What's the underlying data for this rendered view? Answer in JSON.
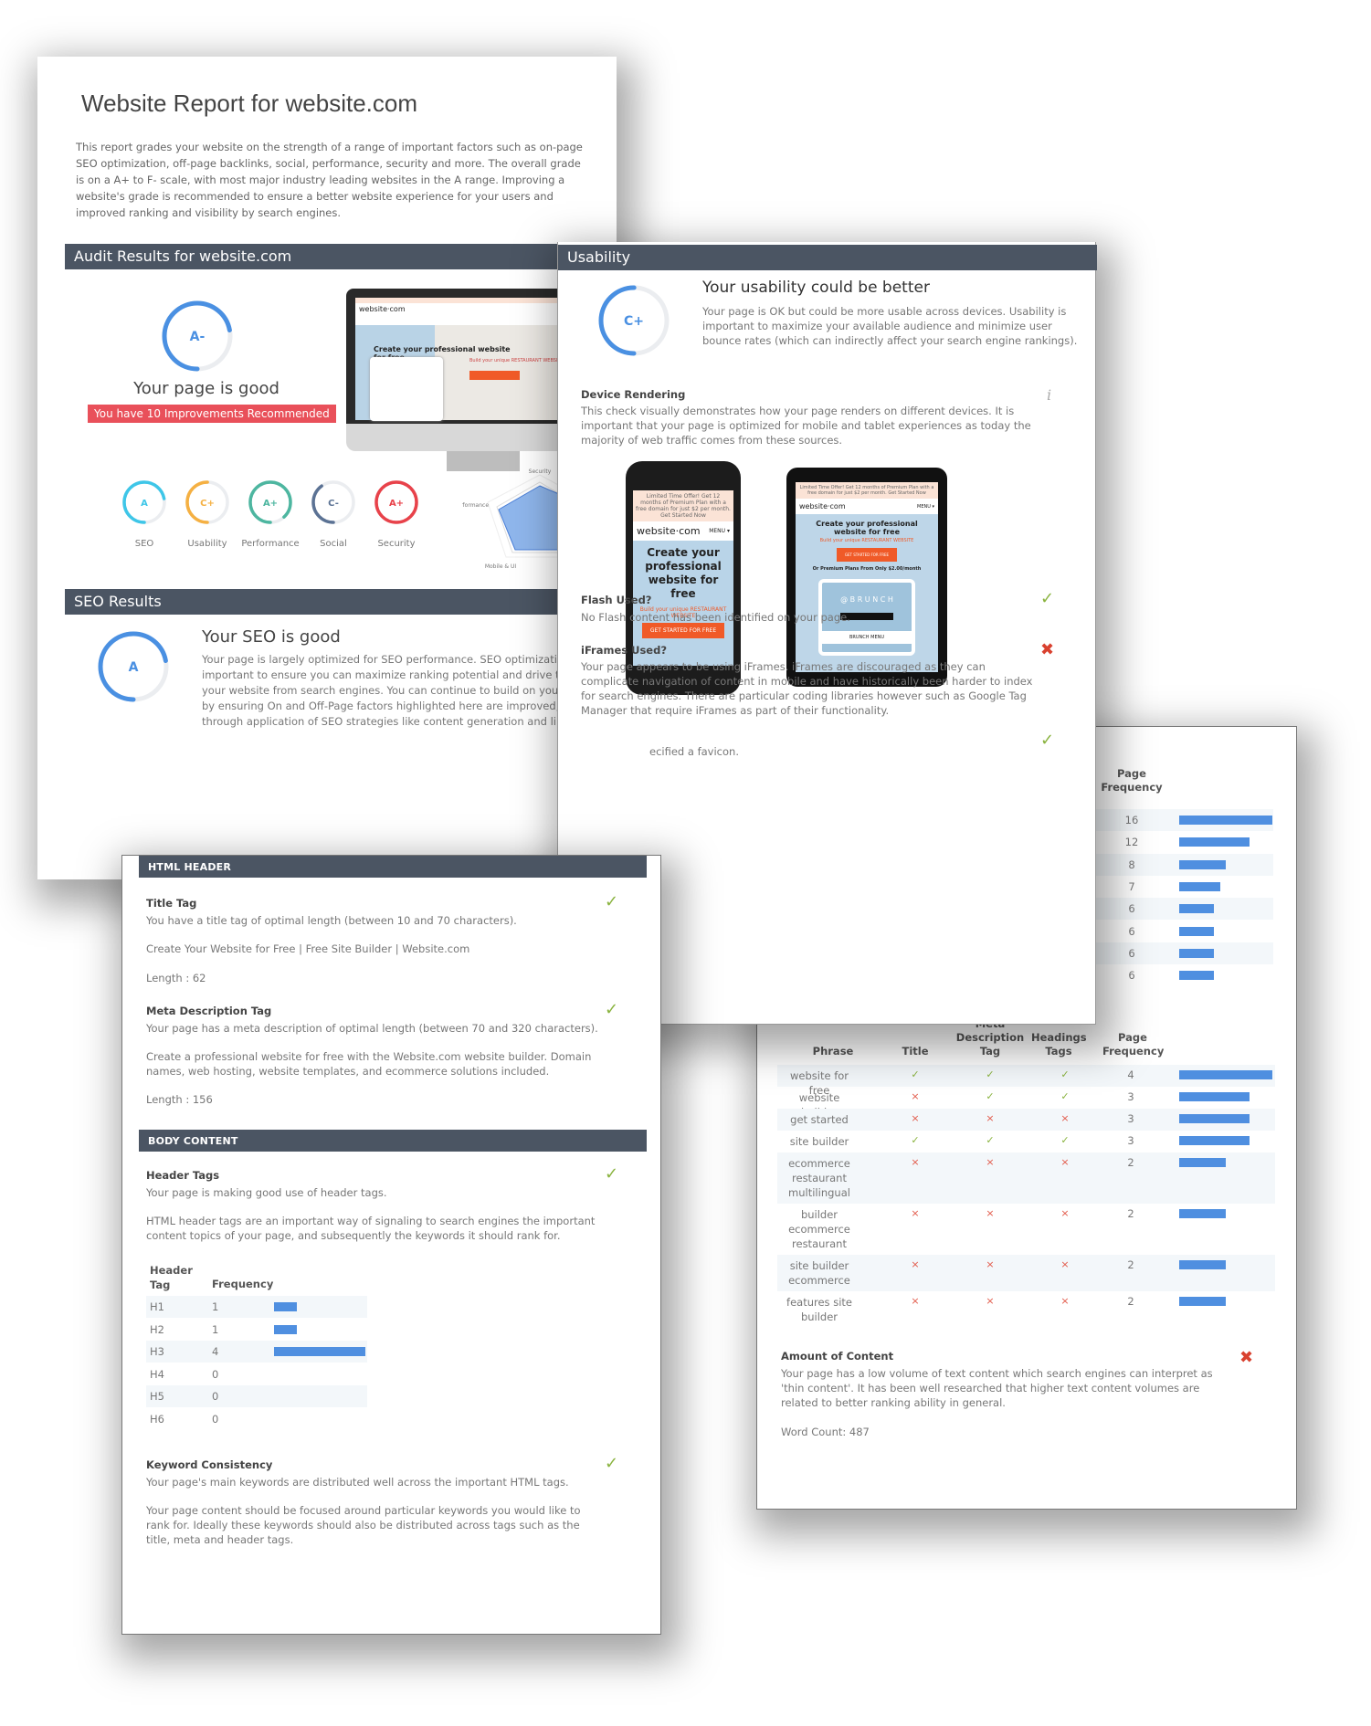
{
  "report": {
    "title": "Website Report for website.com",
    "intro": "This report grades your website on the strength of a range of important factors such as on-page SEO optimization, off-page backlinks, social, performance, security and more. The overall grade is on a A+ to F- scale, with most major industry leading websites in the A range. Improving a website's grade is recommended to ensure a better website experience for your users and improved ranking and visibility by search engines.",
    "audit_header": "Audit Results for website.com",
    "overall_grade": "A-",
    "overall_grade_progress": 0.72,
    "overall_status": "Your page is good",
    "improvements_badge": "You have 10 Improvements Recommended",
    "accent_color": "#4a90e2",
    "category_grades": [
      {
        "label": "SEO",
        "grade": "A",
        "progress": 0.72,
        "color": "#3ec6e8"
      },
      {
        "label": "Usability",
        "grade": "C+",
        "progress": 0.5,
        "color": "#f5b042"
      },
      {
        "label": "Performance",
        "grade": "A+",
        "progress": 0.88,
        "color": "#4db6a0"
      },
      {
        "label": "Social",
        "grade": "C-",
        "progress": 0.4,
        "color": "#5b7294"
      },
      {
        "label": "Security",
        "grade": "A+",
        "progress": 1.0,
        "color": "#e8424a"
      }
    ],
    "radar_labels": [
      "Security",
      "Performance",
      "Mobile & UI"
    ],
    "monitor_preview": {
      "logo": "website·com",
      "headline": "Create your professional website for free",
      "subline": "Build your unique RESTAURANT WEBSITE"
    },
    "seo_header": "SEO Results",
    "seo_grade": "A",
    "seo_grade_progress": 0.72,
    "seo_title": "Your SEO is good",
    "seo_text": [
      "Your page is largely optimized for SEO performance. SEO optimization is",
      "important to ensure you can maximize ranking potential and drive traffic to",
      "your website from search engines. You can continue to build on your positi",
      "by ensuring On and Off-Page factors highlighted here are improved, as we",
      "through application of SEO strategies like content generation and link buil"
    ]
  },
  "usability": {
    "header": "Usability",
    "grade": "C+",
    "grade_progress": 0.5,
    "title": "Your usability could be better",
    "text": "Your page is OK but could be more usable across devices. Usability is important to maximize your available audience and minimize user bounce rates (which can indirectly affect your search engine rankings).",
    "device_rendering": {
      "title": "Device Rendering",
      "text": "This check visually demonstrates how your page renders on different devices. It is important that your page is optimized for mobile and tablet experiences as today the majority of web traffic comes from these sources.",
      "info_icon": "i"
    },
    "phone_preview": {
      "ad": "Limited Time Offer! Get 12 months of Premium Plan with a free domain for just $2 per month. Get Started Now",
      "logo": "website·com",
      "menu": "MENU ▾",
      "headline": "Create your professional website for free",
      "sub": "Build your unique RESTAURANT WEBSITE",
      "cta": "GET STARTED FOR FREE"
    },
    "tablet_preview": {
      "ad": "Limited Time Offer! Get 12 months of Premium Plan with a free domain for just $2 per month. Get Started Now",
      "logo": "website·com",
      "menu": "MENU ▾",
      "headline": "Create your professional website for free",
      "sub": "Build your unique RESTAURANT WEBSITE",
      "cta": "GET STARTED FOR FREE",
      "plans": "Or Premium Plans From Only $2.00/month",
      "card": "@ B R U N C H",
      "card_footer": "BRUNCH MENU"
    },
    "checks": [
      {
        "title": "Flash Used?",
        "text": "No Flash content has been identified on your page.",
        "status": "pass"
      },
      {
        "title": "iFrames Used?",
        "text": "Your page appears to be using iFrames. iFrames are discouraged as they can complicate navigation of content in mobile and have historically been harder to index for search engines. There are particular coding libraries however such as Google Tag Manager that require iFrames as part of their functionality.",
        "status": "fail"
      },
      {
        "title": "",
        "text": "ecified a favicon.",
        "status": "pass"
      }
    ]
  },
  "keywords": {
    "top_table_header": "Page\nFrequency",
    "top_frequencies": [
      16,
      12,
      8,
      7,
      6,
      6,
      6,
      6
    ],
    "columns": [
      "Phrase",
      "Title",
      "Meta Description Tag",
      "Headings Tags",
      "Page Frequency"
    ],
    "phrases": [
      {
        "phrase": "website for free",
        "title": true,
        "meta": true,
        "headings": true,
        "freq": 4
      },
      {
        "phrase": "website builder",
        "title": false,
        "meta": true,
        "headings": true,
        "freq": 3
      },
      {
        "phrase": "get started",
        "title": false,
        "meta": false,
        "headings": false,
        "freq": 3
      },
      {
        "phrase": "site builder",
        "title": true,
        "meta": true,
        "headings": true,
        "freq": 3
      },
      {
        "phrase": "ecommerce restaurant multilingual",
        "title": false,
        "meta": false,
        "headings": false,
        "freq": 2
      },
      {
        "phrase": "builder ecommerce restaurant",
        "title": false,
        "meta": false,
        "headings": false,
        "freq": 2
      },
      {
        "phrase": "site builder ecommerce",
        "title": false,
        "meta": false,
        "headings": false,
        "freq": 2
      },
      {
        "phrase": "features site builder",
        "title": false,
        "meta": false,
        "headings": false,
        "freq": 2
      }
    ],
    "amount_of_content": {
      "title": "Amount of Content",
      "text": "Your page has a low volume of text content which search engines can interpret as 'thin content'. It has been well researched that higher text content volumes are related to better ranking ability in general.",
      "word_count": "Word Count: 487",
      "status": "fail"
    }
  },
  "html_header": {
    "header": "HTML HEADER",
    "title_tag": {
      "title": "Title Tag",
      "text": "You have a title tag of optimal length (between 10 and 70 characters).",
      "value": "Create Your Website for Free | Free Site Builder | Website.com",
      "length": "Length : 62",
      "status": "pass"
    },
    "meta_description": {
      "title": "Meta Description Tag",
      "text": "Your page has a meta description of optimal length (between 70 and 320 characters).",
      "value": "Create a professional website for free with the Website.com website builder. Domain names, web hosting, website templates, and ecommerce solutions included.",
      "length": "Length : 156",
      "status": "pass"
    },
    "body_header": "BODY CONTENT",
    "header_tags": {
      "title": "Header Tags",
      "text": "Your page is making good use of header tags.",
      "detail": "HTML header tags are an important way of signaling to search engines the important content topics of your page, and subsequently the keywords it should rank for.",
      "status": "pass",
      "col_tag": "Header Tag",
      "col_freq": "Frequency",
      "rows": [
        {
          "tag": "H1",
          "freq": 1
        },
        {
          "tag": "H2",
          "freq": 1
        },
        {
          "tag": "H3",
          "freq": 4
        },
        {
          "tag": "H4",
          "freq": 0
        },
        {
          "tag": "H5",
          "freq": 0
        },
        {
          "tag": "H6",
          "freq": 0
        }
      ]
    },
    "keyword_consistency": {
      "title": "Keyword Consistency",
      "text": "Your page's main keywords are distributed well across the important HTML tags.",
      "detail": "Your page content should be focused around particular keywords you would like to rank for. Ideally these keywords should also be distributed across tags such as the title, meta and header tags.",
      "status": "pass"
    }
  },
  "icons": {
    "check": "✓",
    "cross": "✖",
    "x_small": "×"
  }
}
